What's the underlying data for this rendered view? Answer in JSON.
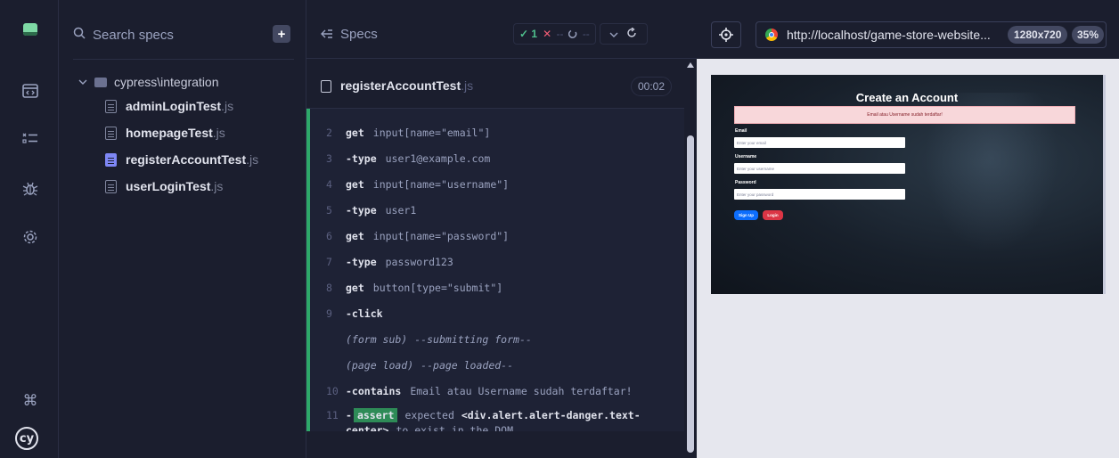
{
  "search": {
    "placeholder": "Search specs"
  },
  "specs_panel": {
    "folder": "cypress\\integration",
    "files": [
      {
        "name": "adminLoginTest",
        "ext": ".js"
      },
      {
        "name": "homepageTest",
        "ext": ".js"
      },
      {
        "name": "registerAccountTest",
        "ext": ".js"
      },
      {
        "name": "userLoginTest",
        "ext": ".js"
      }
    ],
    "active_index": 2
  },
  "log": {
    "specs_label": "Specs",
    "stats": {
      "passed": "1",
      "failed": "--",
      "pending": "--"
    },
    "file": {
      "name": "registerAccountTest",
      "ext": ".js"
    },
    "timer": "00:02",
    "commands": [
      {
        "num": "2",
        "name": "get",
        "arg": "input[name=\"email\"]"
      },
      {
        "num": "3",
        "name": "-type",
        "arg": "user1@example.com"
      },
      {
        "num": "4",
        "name": "get",
        "arg": "input[name=\"username\"]"
      },
      {
        "num": "5",
        "name": "-type",
        "arg": "user1"
      },
      {
        "num": "6",
        "name": "get",
        "arg": "input[name=\"password\"]"
      },
      {
        "num": "7",
        "name": "-type",
        "arg": "password123"
      },
      {
        "num": "8",
        "name": "get",
        "arg": "button[type=\"submit\"]"
      },
      {
        "num": "9",
        "name": "-click",
        "arg": ""
      }
    ],
    "events": [
      {
        "label": "(form sub)",
        "text": "--submitting form--"
      },
      {
        "label": "(page load)",
        "text": "--page loaded--"
      }
    ],
    "contains": {
      "num": "10",
      "name": "-contains",
      "arg": "Email atau Username sudah terdaftar!"
    },
    "assert": {
      "num": "11",
      "dash": "-",
      "badge": "assert",
      "word1": "expected",
      "strong1": "<div.alert.alert-danger.text-",
      "strong2": "center>",
      "rest": "to exist in the DOM"
    }
  },
  "aut": {
    "url": "http://localhost/game-store-website...",
    "viewport": "1280x720",
    "zoom": "35%",
    "page": {
      "title": "Create an Account",
      "alert": "Email atau Username sudah terdaftar!",
      "email_label": "Email",
      "email_placeholder": "Enter your email",
      "username_label": "Username",
      "username_placeholder": "Enter your username",
      "password_label": "Password",
      "password_placeholder": "Enter your password",
      "signup": "Sign Up",
      "login": "Login"
    }
  },
  "colors": {
    "pass": "#4fc08d",
    "fail": "#f15d75",
    "accent": "#6470f3",
    "assert_bg": "#2e8b57"
  }
}
